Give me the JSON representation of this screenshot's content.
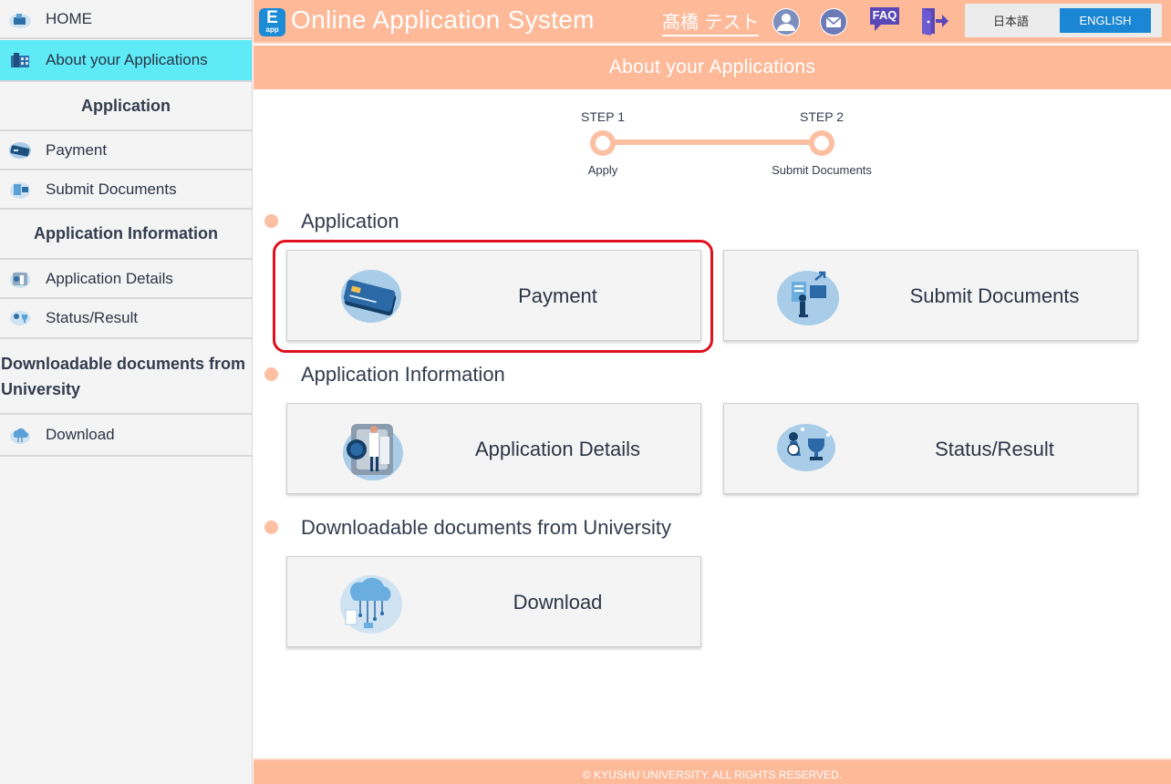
{
  "header": {
    "app_title": "Online Application System",
    "logo_letter": "E",
    "logo_sub": "app",
    "user_name": "髙橋 テスト",
    "icons": [
      "user-icon",
      "mail-icon",
      "faq-icon",
      "logout-icon"
    ],
    "faq_label": "FAQ",
    "lang_ja": "日本語",
    "lang_en": "ENGLISH",
    "selected_language": "ENGLISH",
    "accent_color": "#fdb998",
    "brand_color": "#1b86d4"
  },
  "sidebar": {
    "home": "HOME",
    "about": "About your Applications",
    "section_application": "Application",
    "payment": "Payment",
    "submit_documents": "Submit Documents",
    "section_application_info": "Application Information",
    "application_details": "Application Details",
    "status_result": "Status/Result",
    "section_downloadable": "Downloadable documents from University",
    "download": "Download",
    "active_color": "#5eeaf7"
  },
  "page": {
    "title": "About your Applications",
    "steps": [
      {
        "number": "STEP 1",
        "label": "Apply"
      },
      {
        "number": "STEP 2",
        "label": "Submit Documents"
      }
    ],
    "sections": {
      "application": "Application",
      "application_info": "Application Information",
      "downloadable": "Downloadable documents from University"
    },
    "cards": {
      "payment": "Payment",
      "submit_documents": "Submit Documents",
      "application_details": "Application Details",
      "status_result": "Status/Result",
      "download": "Download"
    }
  },
  "footer": {
    "copyright": "© KYUSHU UNIVERSITY. ALL RIGHTS RESERVED."
  }
}
